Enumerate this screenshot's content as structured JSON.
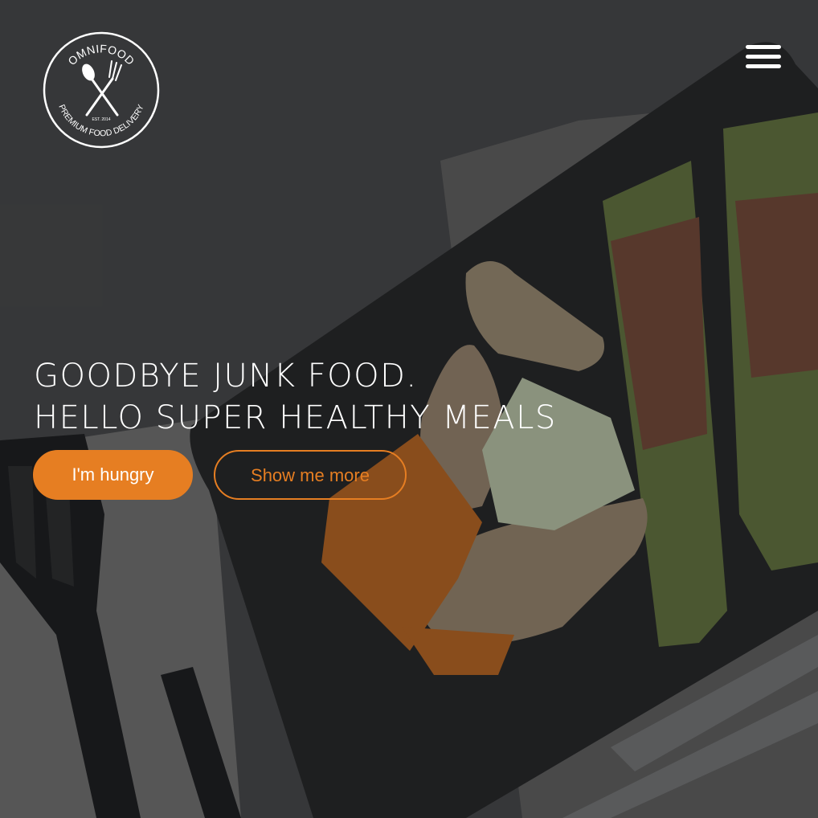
{
  "brand": {
    "name": "OMNIFOOD",
    "tagline": "PREMIUM FOOD DELIVERY",
    "est": "EST. 2014"
  },
  "nav": {
    "menu_icon": "hamburger-menu-icon"
  },
  "hero": {
    "headline_line1": "GOODBYE JUNK FOOD.",
    "headline_line2": "HELLO SUPER HEALTHY MEALS",
    "primary_button": "I'm hungry",
    "secondary_button": "Show me more"
  },
  "colors": {
    "accent": "#e67e22",
    "text": "#ffffff",
    "background": "#3e3f41"
  }
}
